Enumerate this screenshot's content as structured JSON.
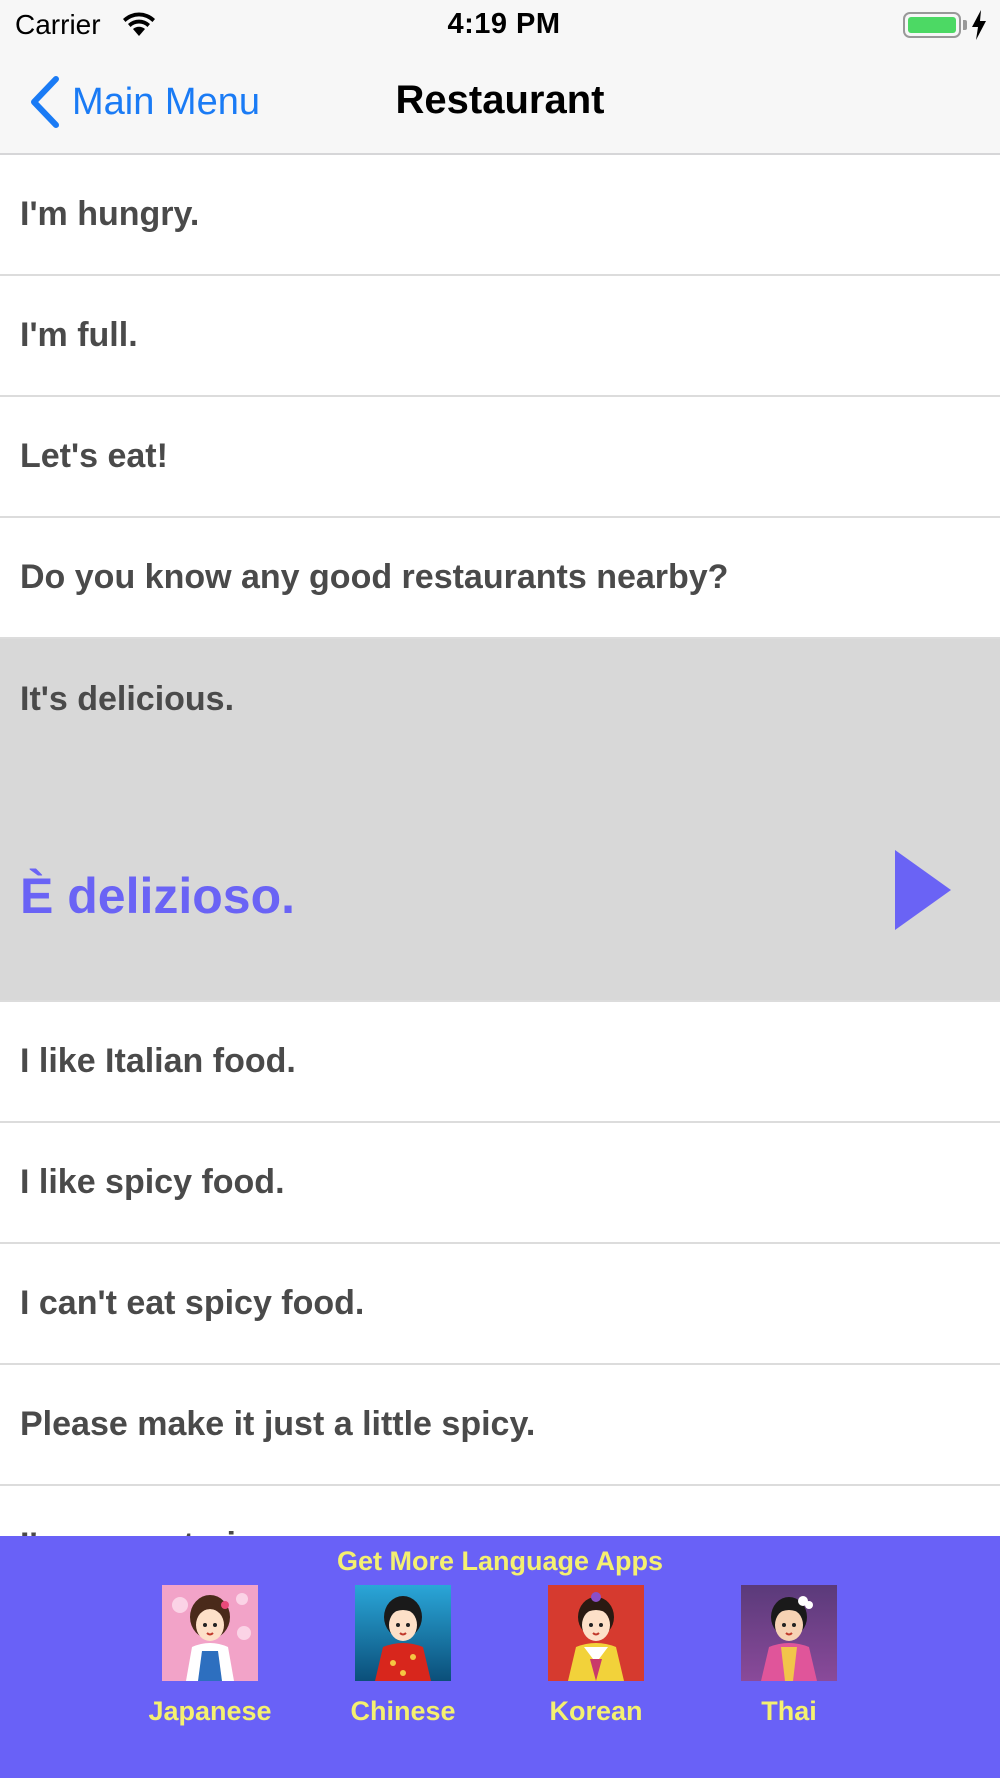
{
  "status_bar": {
    "carrier": "Carrier",
    "time": "4:19 PM",
    "battery_color": "#4cd964"
  },
  "nav": {
    "back_label": "Main Menu",
    "back_icon": "chevron-left-icon",
    "title": "Restaurant",
    "accent_color": "#1a7bf5"
  },
  "list": {
    "items": [
      {
        "label": "I'm hungry."
      },
      {
        "label": "I'm full."
      },
      {
        "label": "Let's eat!"
      },
      {
        "label": "Do you know any good restaurants nearby?"
      },
      {
        "label": "It's delicious.",
        "translation": "È delizioso.",
        "selected": true
      },
      {
        "label": "I like Italian food."
      },
      {
        "label": "I like spicy food."
      },
      {
        "label": "I can't eat spicy food."
      },
      {
        "label": "Please make it just a little spicy."
      },
      {
        "label": "I'm a vegetarian."
      }
    ],
    "translation_color": "#6a63f5",
    "play_icon": "play-icon"
  },
  "banner": {
    "title": "Get More Language Apps",
    "background": "#6961f7",
    "text_color": "#f4f070",
    "apps": [
      {
        "label": "Japanese"
      },
      {
        "label": "Chinese"
      },
      {
        "label": "Korean"
      },
      {
        "label": "Thai"
      }
    ]
  }
}
